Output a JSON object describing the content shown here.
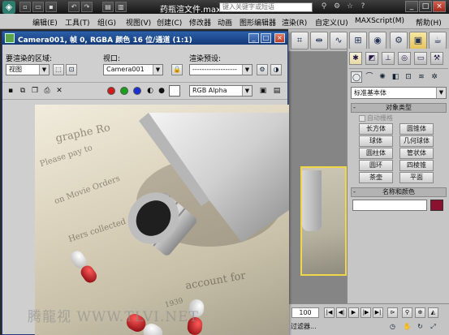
{
  "app": {
    "title": "药瓶渲文件.max",
    "logo_icon": "3dsmax-logo-icon",
    "search_placeholder": "键入关键字或短语",
    "window_controls": [
      "minimize",
      "maximize",
      "close"
    ]
  },
  "menu": {
    "items": [
      "编辑(E)",
      "工具(T)",
      "组(G)",
      "视图(V)",
      "创建(C)",
      "修改器",
      "动画",
      "图形编辑器",
      "渲染(R)",
      "自定义(U)",
      "MAXScript(M)",
      "帮助(H)"
    ]
  },
  "render_frame": {
    "title": "Camera001, 帧 0, RGBA 颜色 16 位/通道 (1:1)",
    "area_label": "要渲染的区域:",
    "area_value": "视图",
    "viewport_label": "视口:",
    "viewport_value": "Camera001",
    "preset_label": "渲染预设:",
    "preset_value": "-------------------",
    "channel_value": "RGB Alpha",
    "channel_colors": {
      "red": "#d11a1a",
      "green": "#18a018",
      "blue": "#1a2fd1"
    }
  },
  "render_image": {
    "doc_lines": [
      "graphe Ro",
      "Please pay to",
      "on Movie Orders",
      "Hers collected",
      "account for",
      "1939"
    ],
    "pill_colors": {
      "cap": "#c8161c",
      "body": "#f2f2f2"
    }
  },
  "viewport": {
    "label_top": "",
    "label_side": ""
  },
  "command_panel": {
    "dropdown_value": "标准基本体",
    "object_type_header": "对象类型",
    "autogrid_label": "自动栅格",
    "objects": [
      "长方体",
      "圆锥体",
      "球体",
      "几何球体",
      "圆柱体",
      "管状体",
      "圆环",
      "四棱锥",
      "茶壶",
      "平面"
    ],
    "name_color_header": "名称和颜色",
    "swatch_color": "#8a1230"
  },
  "bottom": {
    "frame_value": "100",
    "filter_label": "过滤器..."
  },
  "watermark": "腾龍视 WWW.TLVI.NET"
}
